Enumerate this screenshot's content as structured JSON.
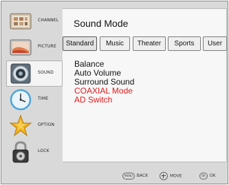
{
  "sidebar": {
    "items": [
      {
        "label": "CHANNEL",
        "icon": "channel-icon",
        "active": false
      },
      {
        "label": "PICTURE",
        "icon": "picture-icon",
        "active": false
      },
      {
        "label": "SOUND",
        "icon": "speaker-icon",
        "active": true
      },
      {
        "label": "TIME",
        "icon": "clock-icon",
        "active": false
      },
      {
        "label": "OPTION",
        "icon": "star-icon",
        "active": false
      },
      {
        "label": "LOCK",
        "icon": "padlock-icon",
        "active": false
      }
    ]
  },
  "panel": {
    "title": "Sound Mode",
    "tabs": [
      {
        "label": "Standard",
        "selected": true
      },
      {
        "label": "Music",
        "selected": false
      },
      {
        "label": "Theater",
        "selected": false
      },
      {
        "label": "Sports",
        "selected": false
      },
      {
        "label": "User",
        "selected": false
      }
    ],
    "options": [
      {
        "label": "Balance",
        "color": "#111111"
      },
      {
        "label": "Auto Volume",
        "color": "#111111"
      },
      {
        "label": "Surround Sound",
        "color": "#111111"
      },
      {
        "label": "COAXIAL Mode",
        "color": "#e31b1b"
      },
      {
        "label": "AD Switch",
        "color": "#e31b1b"
      }
    ]
  },
  "footer": {
    "back_key": "MENU",
    "back_label": "BACK",
    "move_label": "MOVE",
    "ok_key": "OK",
    "ok_label": "OK"
  }
}
